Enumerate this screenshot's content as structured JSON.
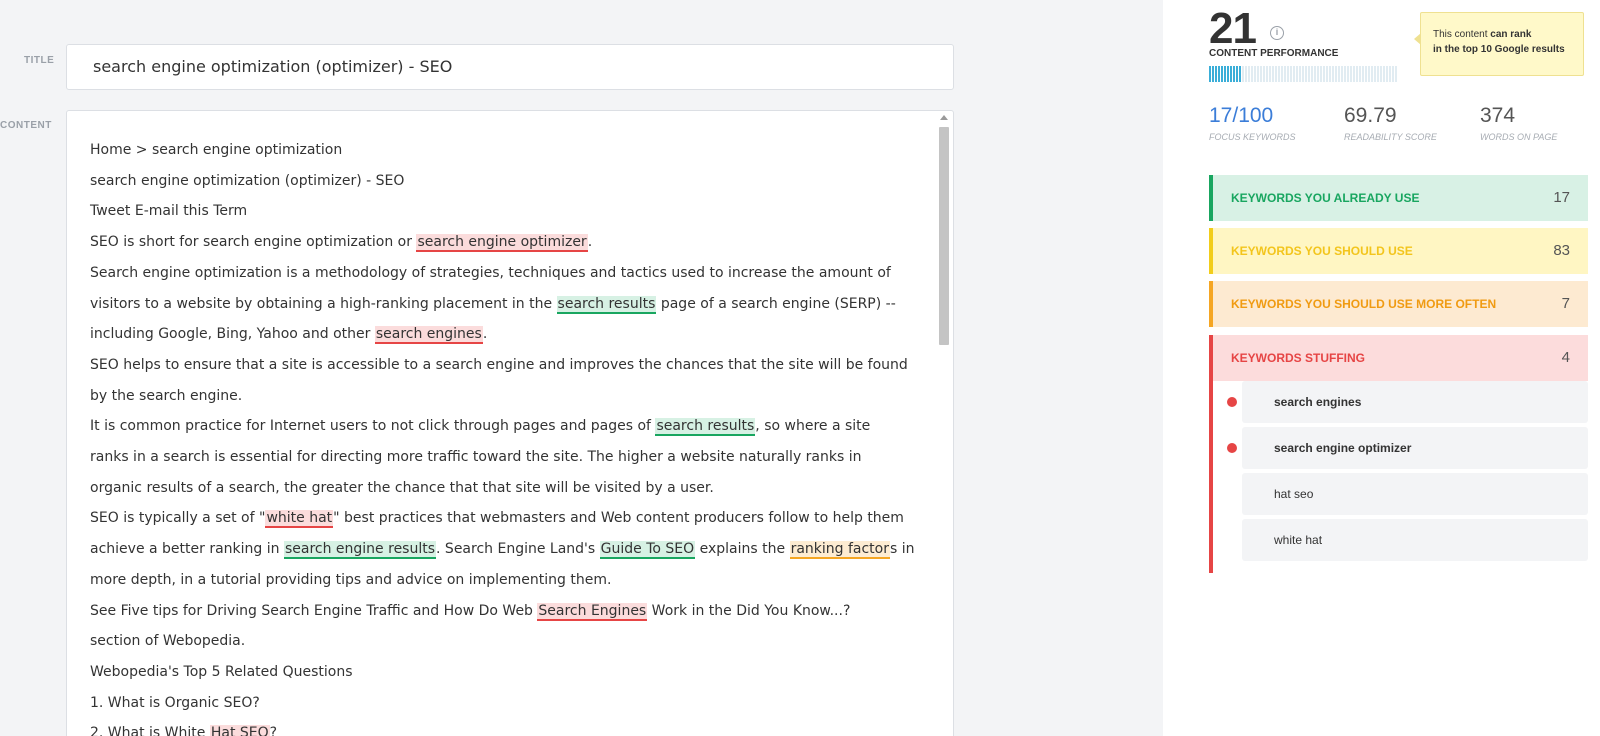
{
  "editor": {
    "title_label": "TITLE",
    "title_value": "search engine optimization (optimizer) - SEO",
    "content_label": "CONTENT",
    "lines": [
      [
        {
          "t": "Home > search engine optimization"
        }
      ],
      [
        {
          "t": "search engine optimization (optimizer) - SEO"
        }
      ],
      [
        {
          "t": "Tweet  E-mail this Term"
        }
      ],
      [
        {
          "t": "SEO is short for search engine optimization or "
        },
        {
          "t": "search engine optimizer",
          "hl": "red"
        },
        {
          "t": "."
        }
      ],
      [
        {
          "t": "Search engine optimization is a methodology of strategies, techniques and tactics used to increase the amount of"
        }
      ],
      [
        {
          "t": "visitors to a website by obtaining a high-ranking placement in the "
        },
        {
          "t": "search results",
          "hl": "green"
        },
        {
          "t": " page of a search engine (SERP) --"
        }
      ],
      [
        {
          "t": "including Google, Bing, Yahoo and other "
        },
        {
          "t": "search engines",
          "hl": "red"
        },
        {
          "t": "."
        }
      ],
      [
        {
          "t": "SEO helps to ensure that a site is accessible to a search engine and improves the chances that the site will be found"
        }
      ],
      [
        {
          "t": "by the search engine."
        }
      ],
      [
        {
          "t": "It is common practice for Internet users to not click through pages and pages of "
        },
        {
          "t": "search results",
          "hl": "green"
        },
        {
          "t": ", so where a site"
        }
      ],
      [
        {
          "t": "ranks in a search is essential for directing more traffic toward the site. The higher a website naturally ranks in"
        }
      ],
      [
        {
          "t": "organic results of a search, the greater the chance that that site will be visited by a user."
        }
      ],
      [
        {
          "t": "SEO is typically a set of \""
        },
        {
          "t": "white hat",
          "hl": "red"
        },
        {
          "t": "\" best practices that webmasters and Web content producers follow to help them"
        }
      ],
      [
        {
          "t": "achieve a better ranking in "
        },
        {
          "t": "search engine results",
          "hl": "green"
        },
        {
          "t": ". Search Engine Land's "
        },
        {
          "t": "Guide To SEO",
          "hl": "green"
        },
        {
          "t": " explains the "
        },
        {
          "t": "ranking factor",
          "hl": "orange"
        },
        {
          "t": "s in"
        }
      ],
      [
        {
          "t": "more depth, in a tutorial providing tips and advice on implementing them."
        }
      ],
      [
        {
          "t": "See Five tips for Driving Search Engine Traffic and How Do Web "
        },
        {
          "t": "Search Engines",
          "hl": "red"
        },
        {
          "t": " Work in the Did You Know...?"
        }
      ],
      [
        {
          "t": "section of Webopedia."
        }
      ],
      [
        {
          "t": "Webopedia's Top 5 Related Questions"
        }
      ],
      [
        {
          "t": "1. What is Organic SEO?"
        }
      ],
      [
        {
          "t": "2. What is White "
        },
        {
          "t": "Hat SEO",
          "hl": "red"
        },
        {
          "t": "?"
        }
      ]
    ]
  },
  "panel": {
    "score": "21",
    "score_label": "CONTENT PERFORMANCE",
    "performance_fraction": 0.21,
    "tooltip": {
      "prefix": "This content ",
      "bold1": "can rank",
      "bold2": "in the top 10 Google results"
    },
    "stats": [
      {
        "value": "17",
        "suffix": "/100",
        "label": "FOCUS KEYWORDS"
      },
      {
        "value": "69.79",
        "suffix": "",
        "label": "READABILITY SCORE"
      },
      {
        "value": "374",
        "suffix": "",
        "label": "WORDS ON PAGE"
      }
    ],
    "groups": [
      {
        "title": "KEYWORDS YOU ALREADY USE",
        "count": "17"
      },
      {
        "title": "KEYWORDS YOU SHOULD USE",
        "count": "83"
      },
      {
        "title": "KEYWORDS YOU SHOULD USE MORE OFTEN",
        "count": "7"
      },
      {
        "title": "KEYWORDS STUFFING",
        "count": "4"
      }
    ],
    "stuffing": [
      {
        "text": "search engines",
        "flag": true
      },
      {
        "text": "search engine optimizer",
        "flag": true
      },
      {
        "text": "hat seo",
        "flag": false
      },
      {
        "text": "white hat",
        "flag": false
      }
    ],
    "colors": {
      "green": "#19a660",
      "yellow": "#f2cd1a",
      "orange": "#f5a623",
      "red": "#e64545",
      "blue": "#3b7dd8",
      "bar": "#3aaed8"
    }
  }
}
